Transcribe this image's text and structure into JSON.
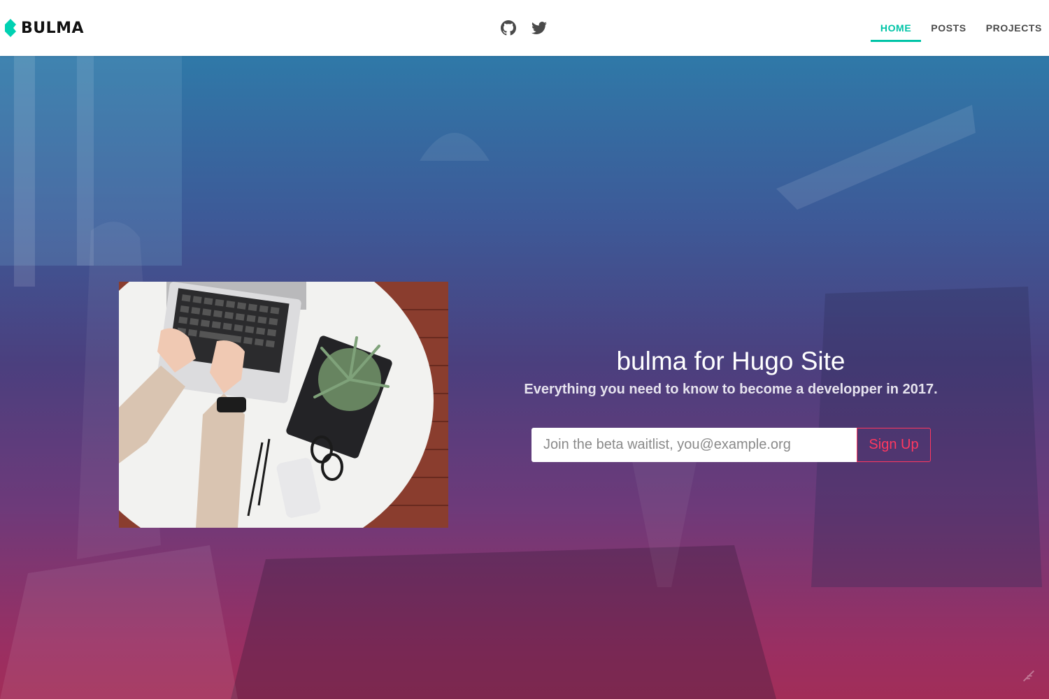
{
  "navbar": {
    "brand": "BULMA",
    "social": [
      {
        "icon": "github-icon",
        "label": "GitHub"
      },
      {
        "icon": "twitter-icon",
        "label": "Twitter"
      }
    ],
    "items": [
      {
        "label": "HOME",
        "active": true
      },
      {
        "label": "POSTS",
        "active": false
      },
      {
        "label": "PROJECTS",
        "active": false
      }
    ]
  },
  "hero": {
    "title": "bulma for Hugo Site",
    "subtitle": "Everything you need to know to become a developper in 2017.",
    "signup": {
      "placeholder": "Join the beta waitlist, you@example.org",
      "button_label": "Sign Up"
    }
  },
  "colors": {
    "accent": "#00c4a7",
    "danger": "#ff3860",
    "gradient_top": "#2f79a8",
    "gradient_bottom": "#a22d58"
  }
}
